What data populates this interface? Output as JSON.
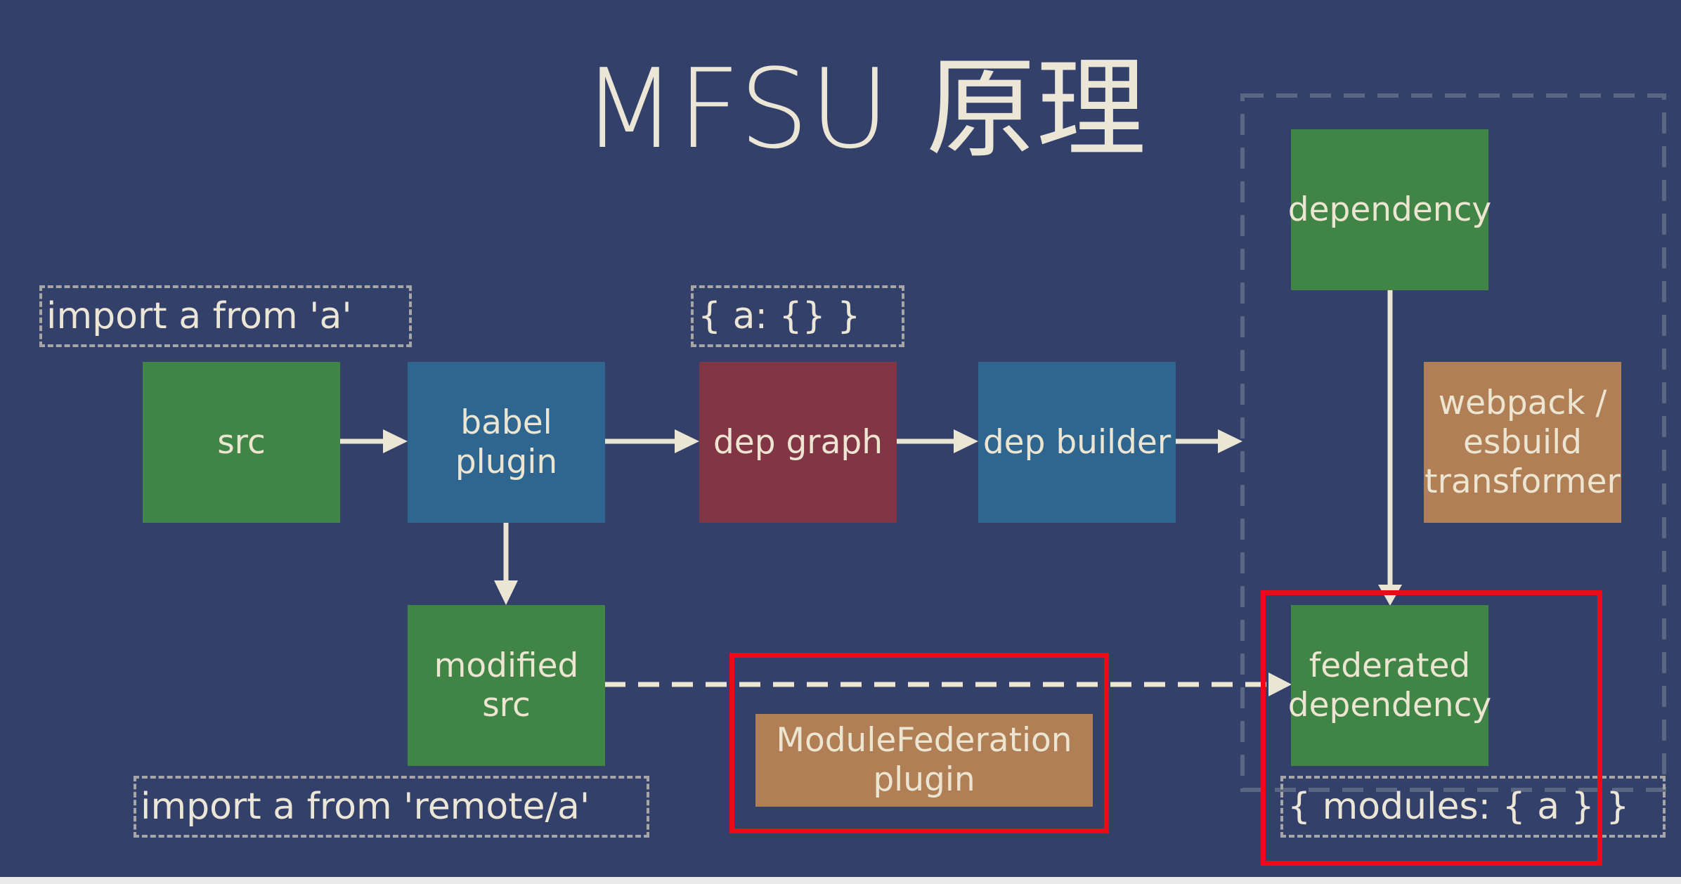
{
  "title": "MFSU 原理",
  "nodes": {
    "src": "src",
    "babel_plugin": "babel plugin",
    "dep_graph": "dep graph",
    "dep_builder": "dep builder",
    "dependency": "dependency",
    "transformer": "webpack / esbuild transformer",
    "modified_src": "modified src",
    "module_federation": "ModuleFederation plugin",
    "federated_dependency": "federated dependency"
  },
  "annotations": {
    "import_a": "import a from 'a'",
    "dep_map": "{ a: {} }",
    "import_remote": "import a from 'remote/a'",
    "modules": "{ modules: { a } }"
  },
  "colors": {
    "background": "#33406a",
    "green": "#418546",
    "blue": "#2f6690",
    "red": "#823545",
    "orange": "#b07f55",
    "highlight": "#ec0a17"
  }
}
